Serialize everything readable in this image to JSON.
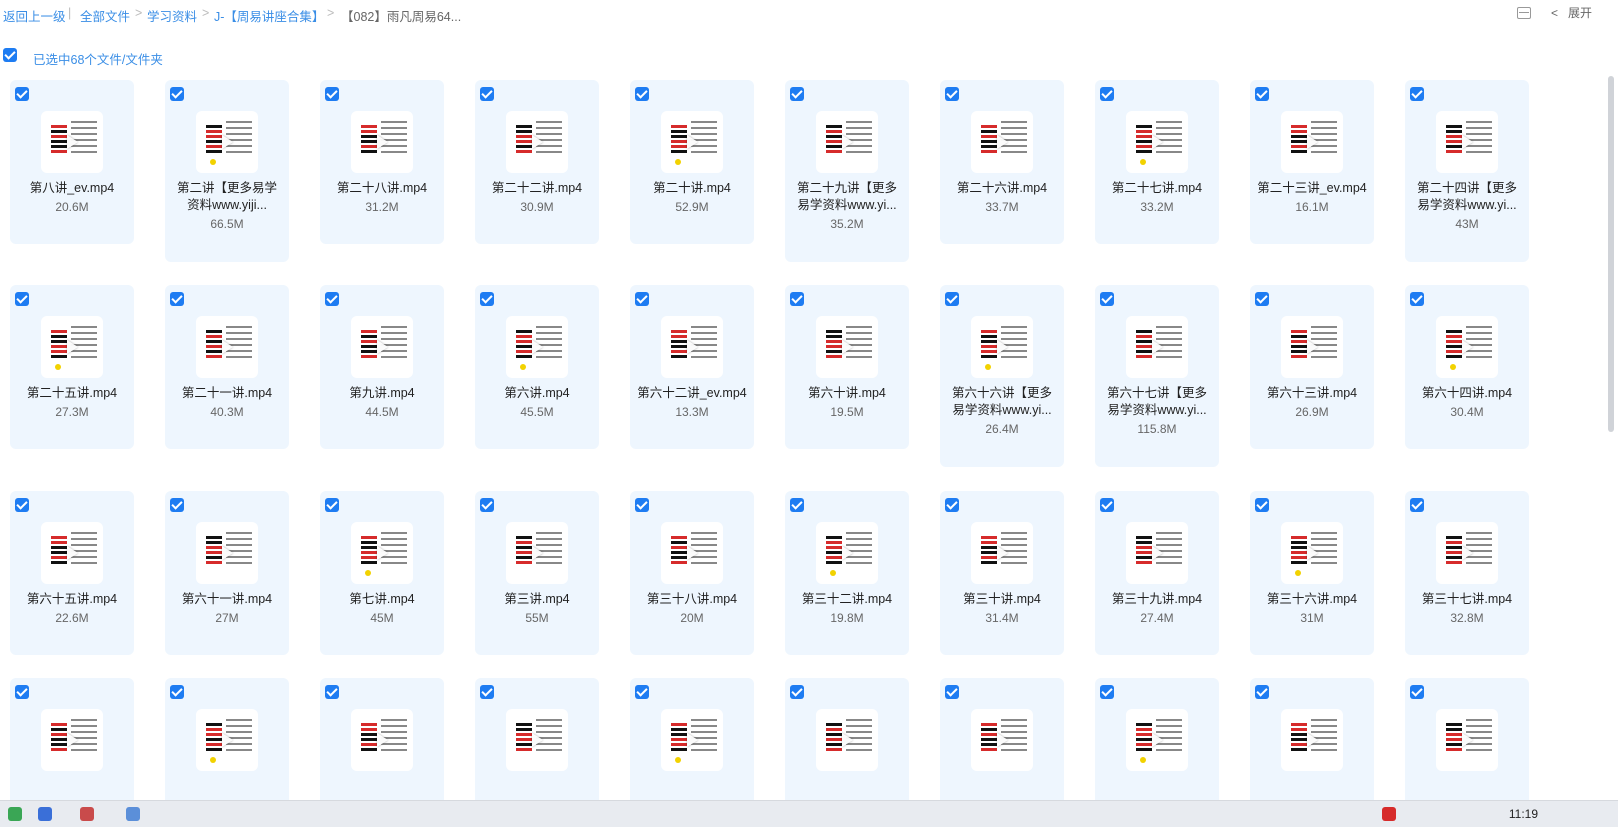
{
  "breadcrumb": {
    "back": "返回上一级",
    "items": [
      "全部文件",
      "学习资料",
      "J-【周易讲座合集】",
      "【082】雨凡周易64..."
    ],
    "separator": ">",
    "pipe": "|"
  },
  "toolbar": {
    "expand_label": "展开",
    "collapse_glyph": "<"
  },
  "selection": {
    "label": "已选中68个文件/文件夹"
  },
  "files": [
    {
      "name": "第八讲_ev.mp4",
      "size": "20.6M"
    },
    {
      "name": "第二讲【更多易学资料www.yiji...",
      "size": "66.5M"
    },
    {
      "name": "第二十八讲.mp4",
      "size": "31.2M"
    },
    {
      "name": "第二十二讲.mp4",
      "size": "30.9M"
    },
    {
      "name": "第二十讲.mp4",
      "size": "52.9M"
    },
    {
      "name": "第二十九讲【更多易学资料www.yi...",
      "size": "35.2M"
    },
    {
      "name": "第二十六讲.mp4",
      "size": "33.7M"
    },
    {
      "name": "第二十七讲.mp4",
      "size": "33.2M"
    },
    {
      "name": "第二十三讲_ev.mp4",
      "size": "16.1M"
    },
    {
      "name": "第二十四讲【更多易学资料www.yi...",
      "size": "43M"
    },
    {
      "name": "第二十五讲.mp4",
      "size": "27.3M"
    },
    {
      "name": "第二十一讲.mp4",
      "size": "40.3M"
    },
    {
      "name": "第九讲.mp4",
      "size": "44.5M"
    },
    {
      "name": "第六讲.mp4",
      "size": "45.5M"
    },
    {
      "name": "第六十二讲_ev.mp4",
      "size": "13.3M"
    },
    {
      "name": "第六十讲.mp4",
      "size": "19.5M"
    },
    {
      "name": "第六十六讲【更多易学资料www.yi...",
      "size": "26.4M"
    },
    {
      "name": "第六十七讲【更多易学资料www.yi...",
      "size": "115.8M"
    },
    {
      "name": "第六十三讲.mp4",
      "size": "26.9M"
    },
    {
      "name": "第六十四讲.mp4",
      "size": "30.4M"
    },
    {
      "name": "第六十五讲.mp4",
      "size": "22.6M"
    },
    {
      "name": "第六十一讲.mp4",
      "size": "27M"
    },
    {
      "name": "第七讲.mp4",
      "size": "45M"
    },
    {
      "name": "第三讲.mp4",
      "size": "55M"
    },
    {
      "name": "第三十八讲.mp4",
      "size": "20M"
    },
    {
      "name": "第三十二讲.mp4",
      "size": "19.8M"
    },
    {
      "name": "第三十讲.mp4",
      "size": "31.4M"
    },
    {
      "name": "第三十九讲.mp4",
      "size": "27.4M"
    },
    {
      "name": "第三十六讲.mp4",
      "size": "31M"
    },
    {
      "name": "第三十七讲.mp4",
      "size": "32.8M"
    },
    {
      "name": "",
      "size": ""
    },
    {
      "name": "",
      "size": ""
    },
    {
      "name": "",
      "size": ""
    },
    {
      "name": "",
      "size": ""
    },
    {
      "name": "",
      "size": ""
    },
    {
      "name": "",
      "size": ""
    },
    {
      "name": "",
      "size": ""
    },
    {
      "name": "",
      "size": ""
    },
    {
      "name": "",
      "size": ""
    },
    {
      "name": "",
      "size": ""
    }
  ],
  "taskbar": {
    "clock": "11:19"
  },
  "colors": {
    "accent": "#1e7cf2",
    "link": "#3a8ee6",
    "card_bg": "#eef6fe",
    "hex_red": "#d62b2b"
  }
}
